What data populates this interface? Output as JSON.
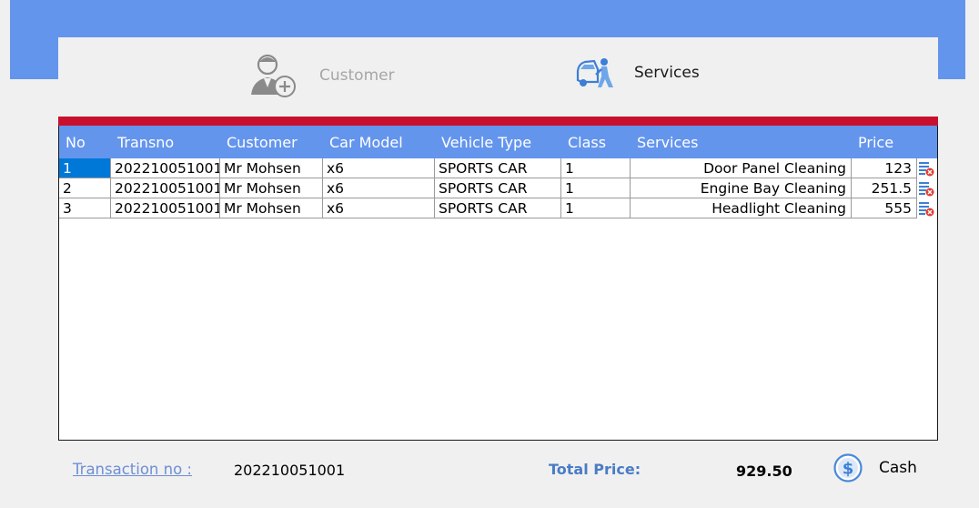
{
  "nav": {
    "customer_label": "Customer",
    "services_label": "Services"
  },
  "table": {
    "columns": [
      "No",
      "Transno",
      "Customer",
      "Car Model",
      "Vehicle Type",
      "Class",
      "Services",
      "Price"
    ],
    "rows": [
      [
        "1",
        "202210051001",
        "Mr Mohsen",
        "x6",
        "SPORTS CAR",
        "1",
        "Door Panel Cleaning",
        "123"
      ],
      [
        "2",
        "202210051001",
        "Mr Mohsen",
        "x6",
        "SPORTS CAR",
        "1",
        "Engine Bay Cleaning",
        "251.5"
      ],
      [
        "3",
        "202210051001",
        "Mr Mohsen",
        "x6",
        "SPORTS CAR",
        "1",
        "Headlight Cleaning",
        "555"
      ]
    ]
  },
  "footer": {
    "transaction_label": "Transaction no :",
    "transaction_value": "202210051001",
    "total_label": "Total Price:",
    "total_value": "929.50",
    "cash_label": "Cash"
  },
  "colors": {
    "accent": "#6495ed",
    "header_strip": "#c8102e",
    "selection": "#0078d7"
  }
}
